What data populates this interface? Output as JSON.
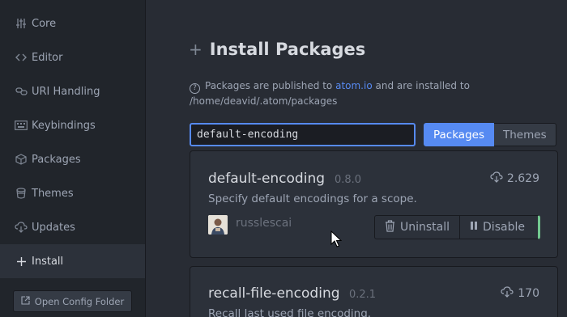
{
  "sidebar": {
    "items": [
      {
        "label": "Core",
        "icon": "settings-sliders-icon"
      },
      {
        "label": "Editor",
        "icon": "code-icon"
      },
      {
        "label": "URI Handling",
        "icon": "link-icon"
      },
      {
        "label": "Keybindings",
        "icon": "keyboard-icon"
      },
      {
        "label": "Packages",
        "icon": "package-icon"
      },
      {
        "label": "Themes",
        "icon": "paintcan-icon"
      },
      {
        "label": "Updates",
        "icon": "cloud-download-icon"
      },
      {
        "label": "Install",
        "icon": "plus-icon",
        "active": true
      }
    ],
    "open_config_label": "Open Config Folder"
  },
  "main": {
    "title": "Install Packages",
    "info_prefix": "Packages are published to",
    "info_link": "atom.io",
    "info_suffix": "and are installed to",
    "info_path": "/home/deavid/.atom/packages",
    "search_value": "default-encoding",
    "tabs": [
      {
        "label": "Packages",
        "selected": true
      },
      {
        "label": "Themes",
        "selected": false
      }
    ],
    "packages": [
      {
        "name": "default-encoding",
        "version": "0.8.0",
        "downloads": "2.629",
        "description": "Specify default encodings for a scope.",
        "author": "russlescai",
        "uninstall_label": "Uninstall",
        "disable_label": "Disable"
      },
      {
        "name": "recall-file-encoding",
        "version": "0.2.1",
        "downloads": "170",
        "description": "Recall last used file encoding."
      }
    ]
  },
  "colors": {
    "accent": "#568af2",
    "enabled_indicator": "#73c990",
    "background": "#282c34",
    "sidebar": "#21252b"
  }
}
